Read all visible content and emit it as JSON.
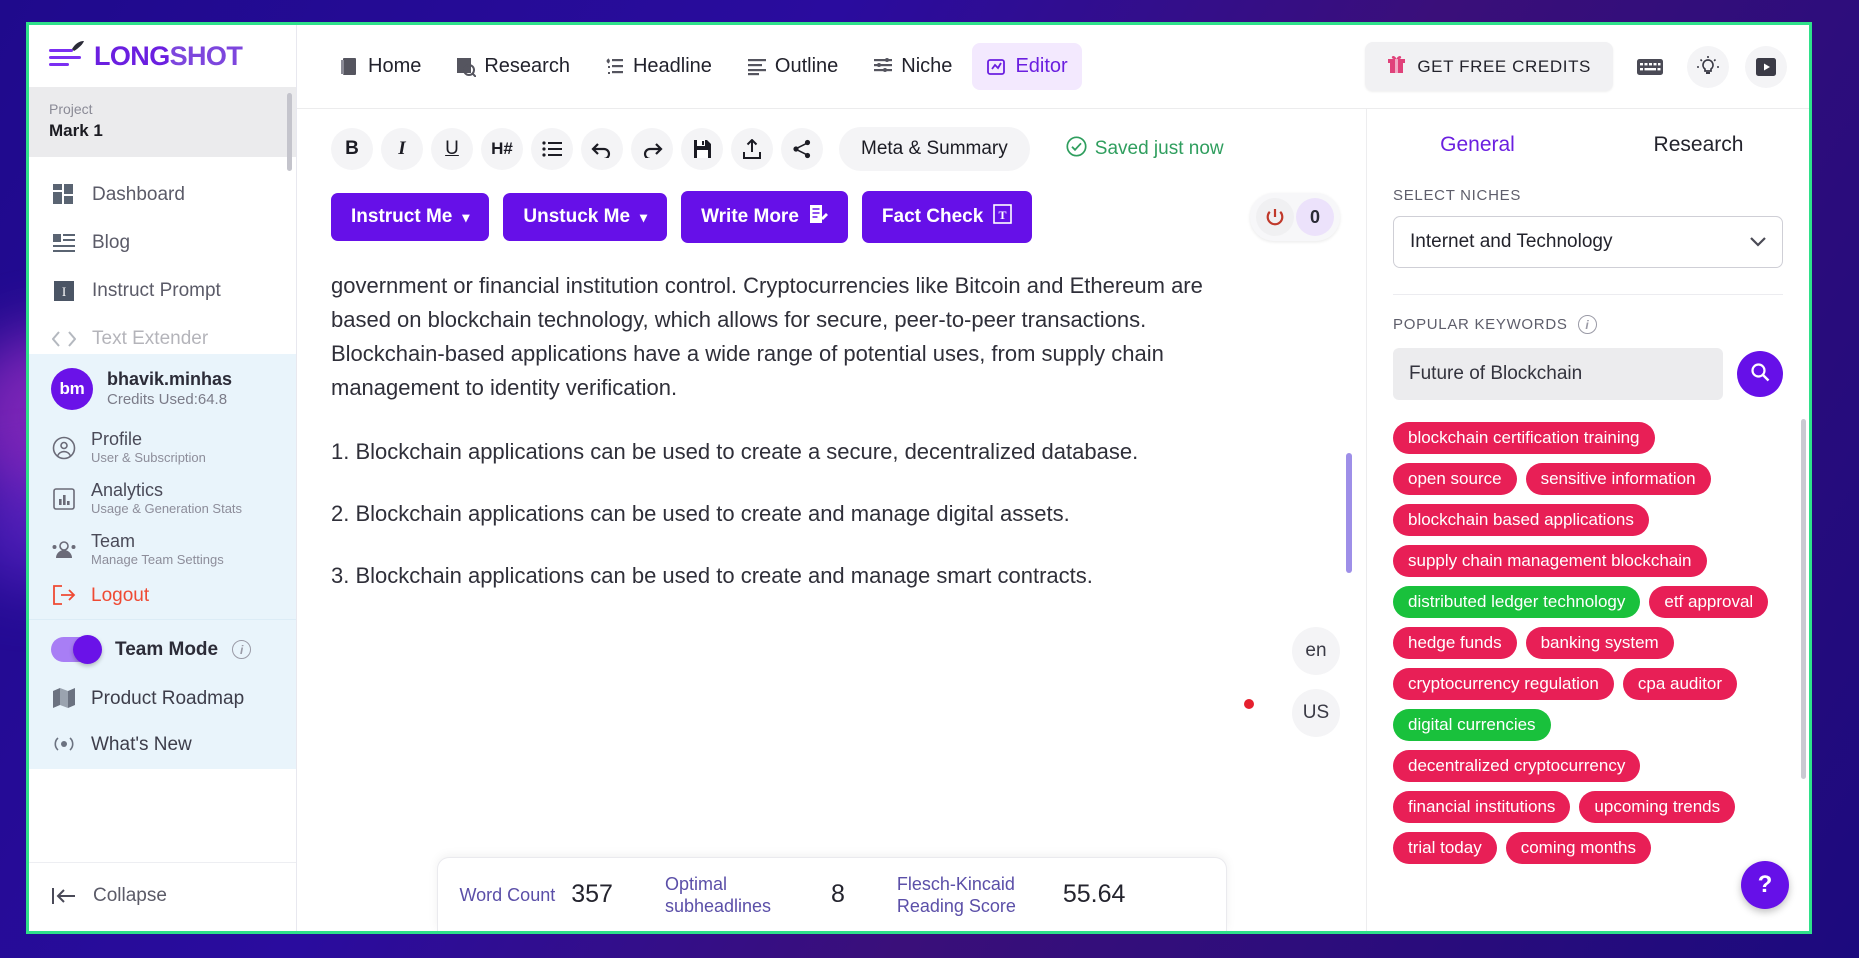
{
  "brand": {
    "name_a": "LONG",
    "name_b": "SHOT",
    "logo_icon": "rocket-icon"
  },
  "sidebar": {
    "project": {
      "caption": "Project",
      "name": "Mark 1"
    },
    "nav": [
      {
        "label": "Dashboard",
        "icon": "dashboard-icon"
      },
      {
        "label": "Blog",
        "icon": "blog-icon"
      },
      {
        "label": "Instruct Prompt",
        "icon": "instruct-prompt-icon"
      },
      {
        "label": "Text Extender",
        "icon": "code-brackets-icon"
      }
    ],
    "account": {
      "initials": "bm",
      "name": "bhavik.minhas",
      "credits": "Credits Used:64.8"
    },
    "menu": [
      {
        "title": "Profile",
        "sub": "User & Subscription",
        "icon": "user-circle-icon"
      },
      {
        "title": "Analytics",
        "sub": "Usage & Generation Stats",
        "icon": "chart-icon"
      },
      {
        "title": "Team",
        "sub": "Manage Team Settings",
        "icon": "team-icon"
      }
    ],
    "logout": {
      "title": "Logout",
      "icon": "logout-icon"
    },
    "team_mode": {
      "label": "Team Mode",
      "enabled": true,
      "info_icon": "info-icon"
    },
    "extras": [
      {
        "label": "Product Roadmap",
        "icon": "map-icon"
      },
      {
        "label": "What's New",
        "icon": "broadcast-icon"
      }
    ],
    "collapse": {
      "label": "Collapse",
      "icon": "collapse-left-icon"
    }
  },
  "topbar": {
    "nav": [
      {
        "label": "Home",
        "icon": "home-doc-icon",
        "active": false
      },
      {
        "label": "Research",
        "icon": "research-icon",
        "active": false
      },
      {
        "label": "Headline",
        "icon": "headline-icon",
        "active": false
      },
      {
        "label": "Outline",
        "icon": "outline-icon",
        "active": false
      },
      {
        "label": "Niche",
        "icon": "niche-icon",
        "active": false
      },
      {
        "label": "Editor",
        "icon": "editor-icon",
        "active": true
      }
    ],
    "credits_button": {
      "label": "GET FREE CREDITS",
      "icon": "gift-icon"
    },
    "icons": [
      {
        "name": "keyboard-icon"
      },
      {
        "name": "lightbulb-icon"
      },
      {
        "name": "video-play-icon"
      }
    ]
  },
  "editor": {
    "format_buttons": [
      {
        "label": "B",
        "name": "bold-button"
      },
      {
        "label": "I",
        "name": "italic-button"
      },
      {
        "label": "U",
        "name": "underline-button"
      },
      {
        "label": "H#",
        "name": "heading-button"
      },
      {
        "label": "",
        "name": "bullet-list-button"
      },
      {
        "label": "",
        "name": "undo-button"
      },
      {
        "label": "",
        "name": "redo-button"
      },
      {
        "label": "",
        "name": "save-button"
      },
      {
        "label": "",
        "name": "export-button"
      },
      {
        "label": "",
        "name": "share-button"
      }
    ],
    "meta_summary_label": "Meta & Summary",
    "saved_status": "Saved just now",
    "actions": [
      {
        "label": "Instruct Me",
        "suffix": "▾"
      },
      {
        "label": "Unstuck Me",
        "suffix": "▾"
      },
      {
        "label": "Write More",
        "suffix": ""
      },
      {
        "label": "Fact Check",
        "suffix": ""
      }
    ],
    "power_badge": {
      "count": "0"
    },
    "document": {
      "paragraph_1": "government or financial institution control. Cryptocurrencies like Bitcoin and Ethereum are based on blockchain technology, which allows for secure, peer-to-peer transactions. Blockchain-based applications have a wide range of potential uses, from supply chain management to identity verification.",
      "item_1": "1. Blockchain applications can be used to create a secure, decentralized database.",
      "item_2": "2. Blockchain applications can be used to create and manage digital assets.",
      "item_3": "3. Blockchain applications can be used to create and manage smart contracts."
    },
    "language_badges": [
      "en",
      "US"
    ],
    "stats": [
      {
        "key": "Word Count",
        "value": "357"
      },
      {
        "key": "Optimal subheadlines",
        "value": "8"
      },
      {
        "key": "Flesch-Kincaid Reading Score",
        "value": "55.64"
      }
    ]
  },
  "right_panel": {
    "tabs": [
      {
        "label": "General",
        "active": true
      },
      {
        "label": "Research",
        "active": false
      }
    ],
    "niches_label": "SELECT NICHES",
    "niche_selected": "Internet and Technology",
    "keywords_label": "POPULAR KEYWORDS",
    "keyword_query": "Future of Blockchain",
    "keyword_placeholder": "Future of Blockchain",
    "colors": {
      "pink": "#e81f56",
      "green": "#19c13c",
      "accent": "#6610e8"
    },
    "tags": [
      {
        "text": "blockchain certification training",
        "color": "pink"
      },
      {
        "text": "open source",
        "color": "pink"
      },
      {
        "text": "sensitive information",
        "color": "pink"
      },
      {
        "text": "blockchain based applications",
        "color": "pink"
      },
      {
        "text": "supply chain management blockchain",
        "color": "pink"
      },
      {
        "text": "distributed ledger technology",
        "color": "green"
      },
      {
        "text": "etf approval",
        "color": "pink"
      },
      {
        "text": "hedge funds",
        "color": "pink"
      },
      {
        "text": "banking system",
        "color": "pink"
      },
      {
        "text": "cryptocurrency regulation",
        "color": "pink"
      },
      {
        "text": "cpa auditor",
        "color": "pink"
      },
      {
        "text": "digital currencies",
        "color": "green"
      },
      {
        "text": "decentralized cryptocurrency",
        "color": "pink"
      },
      {
        "text": "financial institutions",
        "color": "pink"
      },
      {
        "text": "upcoming trends",
        "color": "pink"
      },
      {
        "text": "trial today",
        "color": "pink"
      },
      {
        "text": "coming months",
        "color": "pink"
      }
    ],
    "help_label": "?"
  }
}
